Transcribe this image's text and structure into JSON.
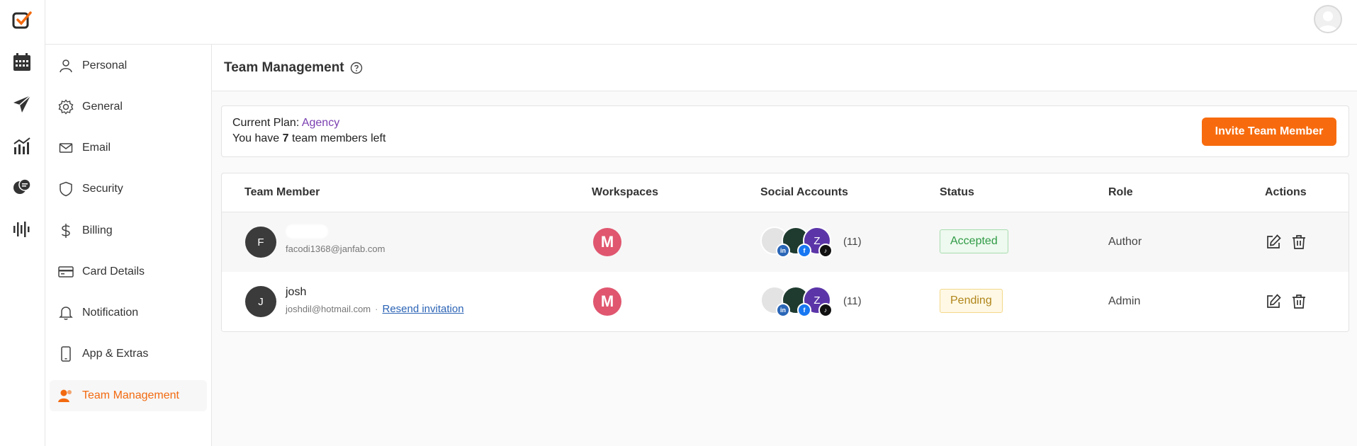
{
  "rail": {
    "icons": [
      "logo-check-icon",
      "calendar-icon",
      "send-icon",
      "analytics-icon",
      "chat-icon",
      "audio-wave-icon"
    ],
    "accent": "#f26a10"
  },
  "sidebar": {
    "items": [
      {
        "label": "Personal",
        "icon": "user-icon"
      },
      {
        "label": "General",
        "icon": "gear-icon"
      },
      {
        "label": "Email",
        "icon": "mail-icon"
      },
      {
        "label": "Security",
        "icon": "shield-icon"
      },
      {
        "label": "Billing",
        "icon": "dollar-icon"
      },
      {
        "label": "Card Details",
        "icon": "card-icon"
      },
      {
        "label": "Notification",
        "icon": "bell-icon"
      },
      {
        "label": "App & Extras",
        "icon": "phone-icon"
      },
      {
        "label": "Team Management",
        "icon": "team-icon",
        "active": true
      }
    ]
  },
  "page": {
    "title": "Team Management"
  },
  "plan": {
    "label": "Current Plan: ",
    "name": "Agency",
    "left_prefix": "You have ",
    "left_count": "7",
    "left_suffix": " team members left",
    "invite_label": "Invite Team Member"
  },
  "table": {
    "headers": {
      "member": "Team Member",
      "workspaces": "Workspaces",
      "social": "Social Accounts",
      "status": "Status",
      "role": "Role",
      "actions": "Actions"
    },
    "rows": [
      {
        "initial": "F",
        "name": "",
        "email": "facodi1368@janfab.com",
        "workspace": "M",
        "social_initial": "Z",
        "social_count": "(11)",
        "status": "Accepted",
        "role": "Author"
      },
      {
        "initial": "J",
        "name": "josh",
        "email": "joshdil@hotmail.com",
        "resend": "Resend invitation",
        "workspace": "M",
        "social_initial": "Z",
        "social_count": "(11)",
        "status": "Pending",
        "role": "Admin"
      }
    ]
  },
  "colors": {
    "accent": "#f76b0e",
    "plan_name": "#7a3fb0",
    "workspace": "#e0566f",
    "accepted": "#2e9b45",
    "pending": "#b0851a"
  }
}
